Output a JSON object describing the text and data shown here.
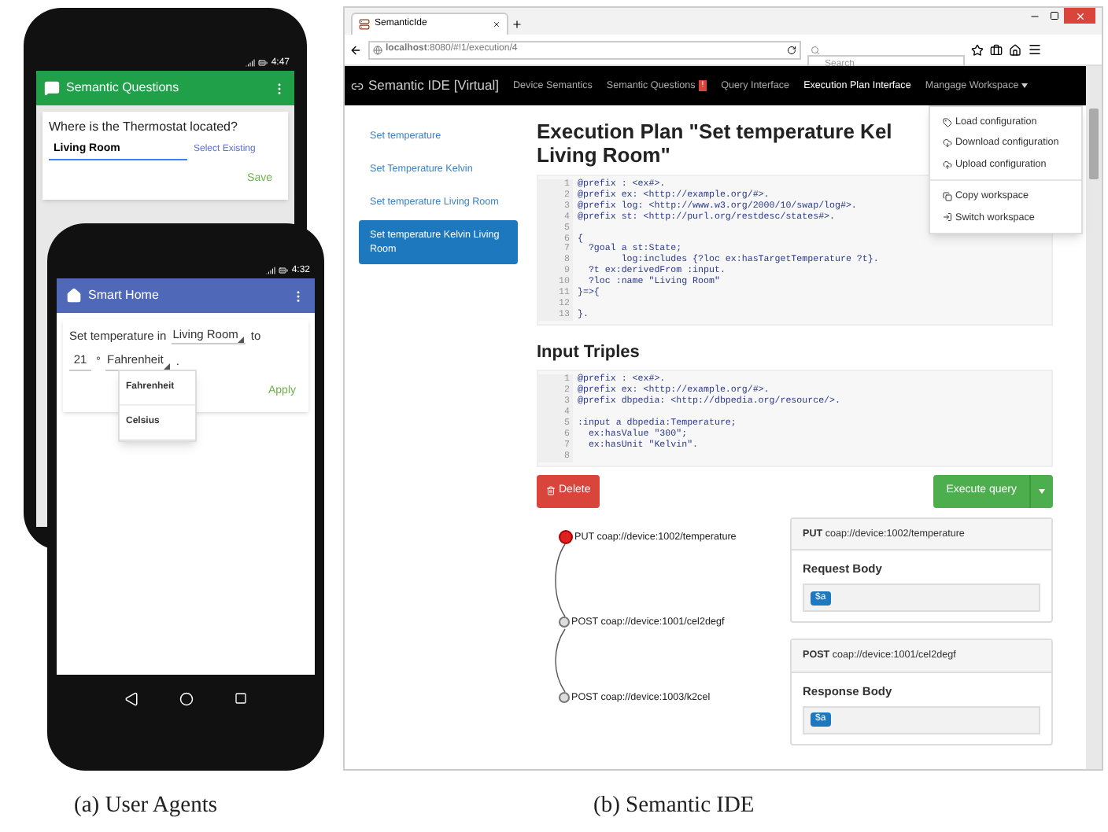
{
  "phone_questions": {
    "time": "4:47",
    "title": "Semantic Questions",
    "question": "Where is the Thermostat located?",
    "answer_value": "Living Room",
    "link": "Select Existing",
    "save": "Save"
  },
  "phone_home": {
    "time": "4:32",
    "title": "Smart Home",
    "prefix": "Set temperature in",
    "room_select": "Living Room",
    "to": "to",
    "value": "21",
    "degree": "°",
    "unit_select": "Fahrenheit",
    "period": ".",
    "unit_menu": [
      "Fahrenheit",
      "Celsius"
    ],
    "apply": "Apply"
  },
  "browser": {
    "tab": "SemanticIde",
    "url": "**localhost**:8080/#!1/execution/4",
    "search_placeholder": "Search",
    "brand": "Semantic IDE [Virtual]",
    "nav": [
      {
        "label": "Device Semantics",
        "selected": false
      },
      {
        "label": "Semantic Questions",
        "selected": false,
        "badge": "!"
      },
      {
        "label": "Query Interface",
        "selected": false
      },
      {
        "label": "Execution Plan Interface",
        "selected": true
      },
      {
        "label": "Mangage Workspace",
        "selected": false,
        "dropdown": true
      }
    ],
    "menu_groups": [
      [
        {
          "kind": "tag",
          "label": "Load configuration"
        },
        {
          "kind": "download",
          "label": "Download configuration"
        },
        {
          "kind": "upload",
          "label": "Upload configuration"
        }
      ],
      [
        {
          "kind": "copy",
          "label": "Copy workspace"
        },
        {
          "kind": "switch",
          "label": "Switch workspace"
        }
      ]
    ],
    "sidebar": [
      {
        "label": "Set temperature",
        "selected": false
      },
      {
        "label": "Set Temperature Kelvin",
        "selected": false
      },
      {
        "label": "Set temperature Living Room",
        "selected": false
      },
      {
        "label": "Set temperature Kelvin Living Room",
        "selected": true
      }
    ],
    "heading_lines": [
      "Execution Plan \"Set temperature Kel",
      "Living Room\""
    ],
    "plan_code": [
      {
        "n": "1",
        "text": "@prefix : <ex#>."
      },
      {
        "n": "2",
        "text": "@prefix ex: <http://example.org/#>."
      },
      {
        "n": "3",
        "text": "@prefix log: <http://www.w3.org/2000/10/swap/log#>."
      },
      {
        "n": "4",
        "text": "@prefix st: <http://purl.org/restdesc/states#>."
      },
      {
        "n": "5"
      },
      {
        "n": "6",
        "text": "{"
      },
      {
        "n": "7",
        "text": "  ?goal a st:State;"
      },
      {
        "n": "8",
        "text": "        log:includes {?loc ex:hasTargetTemperature ?t}."
      },
      {
        "n": "9",
        "text": "  ?t ex:derivedFrom :input."
      },
      {
        "n": "10",
        "text": "  ?loc :name \"Living Room\""
      },
      {
        "n": "11",
        "text": "}=>{"
      },
      {
        "n": "12"
      },
      {
        "n": "13",
        "text": "}."
      }
    ],
    "input_heading": "Input Triples",
    "input_code": [
      {
        "n": "1",
        "text": "@prefix : <ex#>."
      },
      {
        "n": "2",
        "text": "@prefix ex: <http://example.org/#>."
      },
      {
        "n": "3",
        "text": "@prefix dbpedia: <http://dbpedia.org/resource/>."
      },
      {
        "n": "4"
      },
      {
        "n": "5",
        "text": ":input a dbpedia:Temperature;"
      },
      {
        "n": "6",
        "text": "  ex:hasValue \"300\";"
      },
      {
        "n": "7",
        "text": "  ex:hasUnit \"Kelvin\"."
      },
      {
        "n": "8"
      }
    ],
    "delete_button": "Delete",
    "execute_button": "Execute query",
    "graph_nodes": [
      {
        "label": "PUT coap://device:1002/temperature",
        "active": true
      },
      {
        "label": "POST coap://device:1001/cel2degf",
        "active": false
      },
      {
        "label": "POST coap://device:1003/k2cel",
        "active": false
      }
    ],
    "panels": [
      {
        "method": "PUT",
        "url": "coap://device:1002/temperature",
        "body_label": "Request Body",
        "token": "$a"
      },
      {
        "method": "POST",
        "url": "coap://device:1001/cel2degf",
        "body_label": "Response Body",
        "token": "$a"
      }
    ]
  },
  "captions": [
    {
      "tag": "(a)",
      "text": "User Agents"
    },
    {
      "tag": "(b)",
      "text": "Semantic IDE"
    }
  ]
}
